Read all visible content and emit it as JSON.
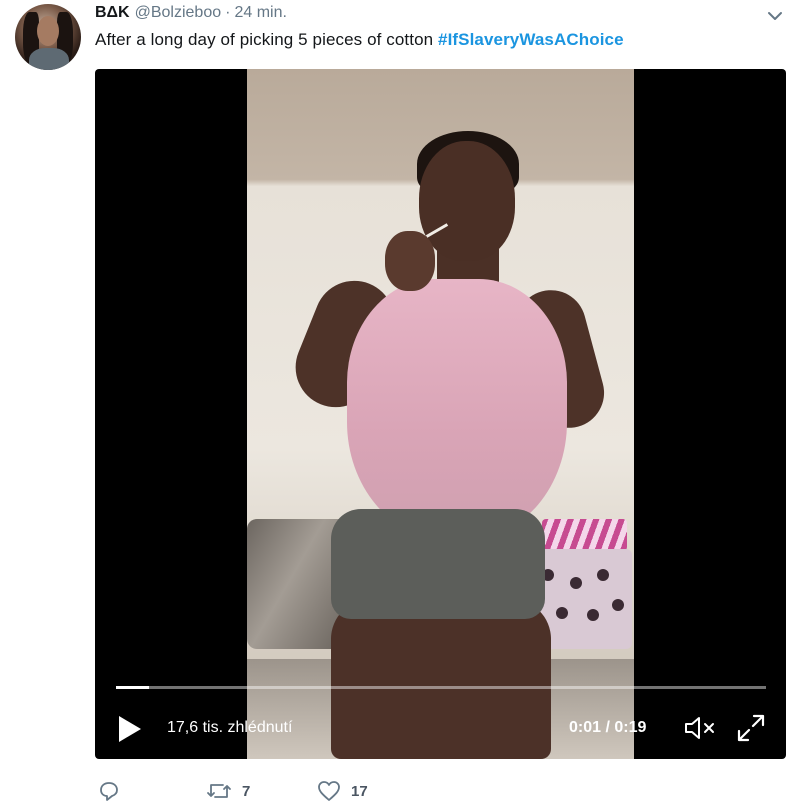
{
  "tweet": {
    "display_name": "BΔK",
    "handle": "@Bolzieboo",
    "separator": "·",
    "timestamp": "24 min.",
    "text": "After a long day of picking 5 pieces of cotton",
    "hashtag": "#IfSlaveryWasAChoice"
  },
  "video": {
    "views": "17,6 tis. zhlédnutí",
    "time": "0:01 / 0:19",
    "progress": 0.05
  },
  "actions": {
    "reply_count": "",
    "retweet_count": "7",
    "like_count": "17"
  },
  "icons": {
    "more": "chevron-down-icon",
    "reply": "reply-icon",
    "retweet": "retweet-icon",
    "like": "heart-icon",
    "play": "play-icon",
    "mute": "volume-muted-icon",
    "fullscreen": "fullscreen-icon"
  },
  "colors": {
    "hashtag": "#1b95e0",
    "secondary_text": "#657786"
  }
}
